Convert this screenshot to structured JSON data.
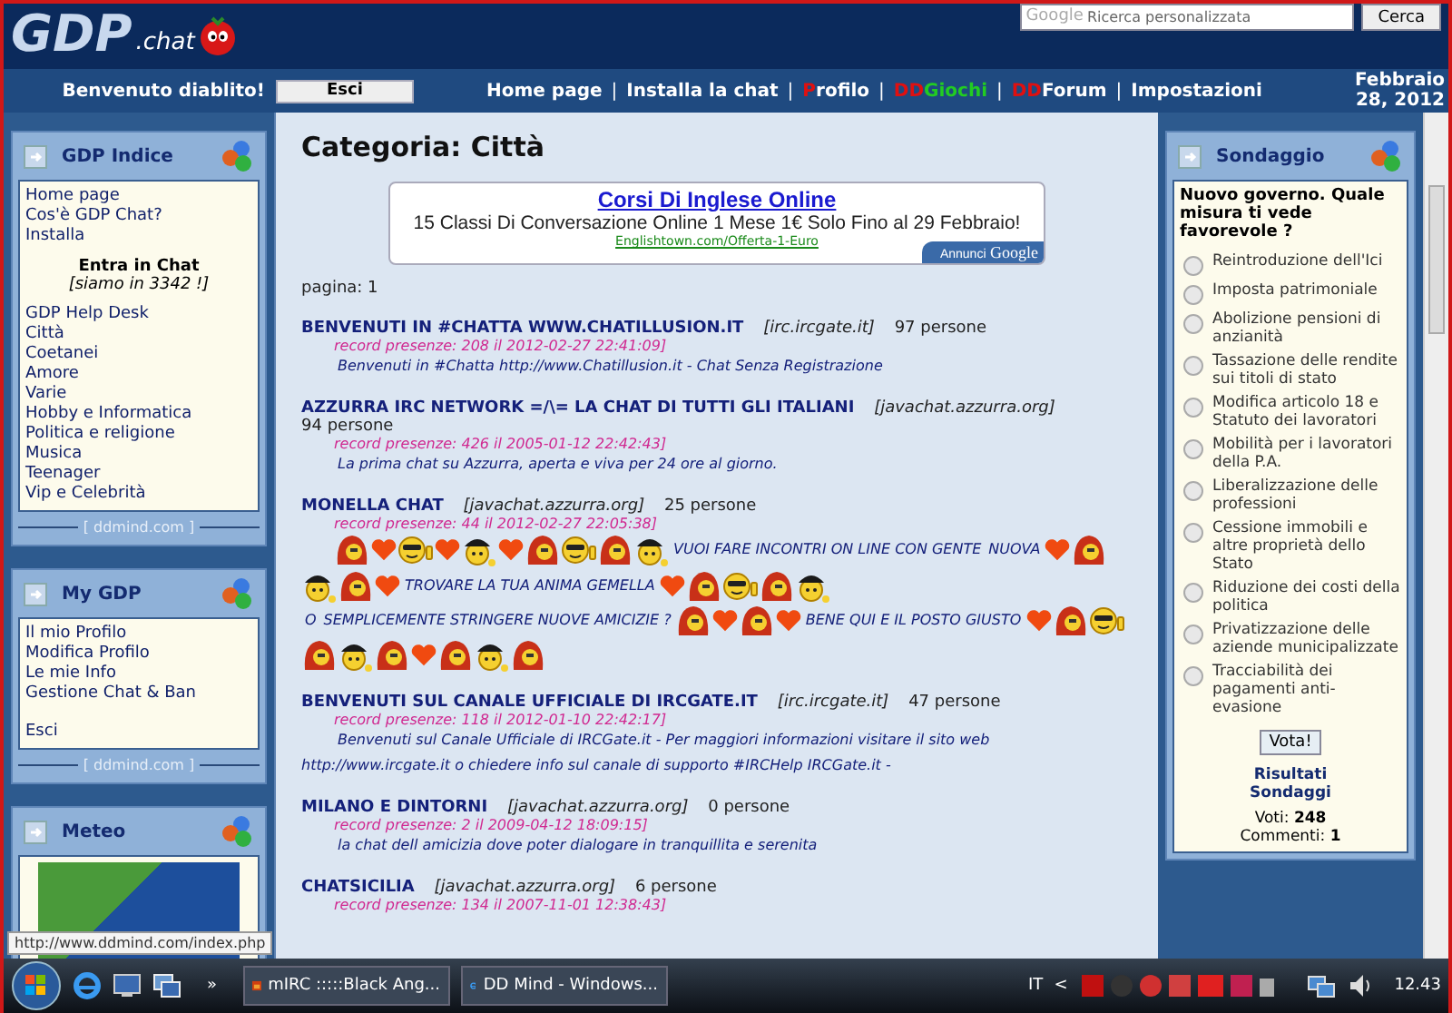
{
  "header": {
    "logo": "GDP",
    "logo_suffix": ".chat",
    "search": {
      "brand": "Google",
      "placeholder": "Ricerca personalizzata",
      "button": "Cerca"
    }
  },
  "navbar": {
    "welcome": "Benvenuto diablito!",
    "logout_button": "Esci",
    "links": [
      {
        "parts": [
          {
            "text": "Home page"
          }
        ]
      },
      {
        "parts": [
          {
            "text": "Installa la chat"
          }
        ]
      },
      {
        "parts": [
          {
            "text": "P",
            "color": "#e01010"
          },
          {
            "text": "rofilo"
          }
        ]
      },
      {
        "parts": [
          {
            "text": "DD",
            "color": "#e01010"
          },
          {
            "text": "Giochi",
            "color": "#22cc22"
          }
        ]
      },
      {
        "parts": [
          {
            "text": "DD",
            "color": "#e01010"
          },
          {
            "text": "Forum"
          }
        ]
      },
      {
        "parts": [
          {
            "text": "Impostazioni"
          }
        ]
      }
    ],
    "separator": "|",
    "date": "Febbraio 28, 2012"
  },
  "left_sidebar": [
    {
      "title": "GDP Indice",
      "kind": "index",
      "footer": "[ ddmind.com ]",
      "links_top": [
        "Home page",
        "Cos'è GDP Chat?",
        "Installa"
      ],
      "enter_title": "Entra in Chat",
      "enter_count": "[siamo in 3342 !]",
      "links": [
        "GDP Help Desk",
        "Città",
        "Coetanei",
        "Amore",
        "Varie",
        "Hobby e Informatica",
        "Politica e religione",
        "Musica",
        "Teenager",
        "Vip e Celebrità"
      ]
    },
    {
      "title": "My GDP",
      "kind": "links",
      "footer": "[ ddmind.com ]",
      "links_top": [
        "Il mio Profilo",
        "Modifica Profilo",
        "Le mie Info",
        "Gestione Chat & Ban"
      ],
      "links": [
        "Esci"
      ]
    },
    {
      "title": "Meteo",
      "kind": "image"
    }
  ],
  "main": {
    "heading": "Categoria: Città",
    "ad": {
      "title": "Corsi Di Inglese Online",
      "text": "15 Classi Di Conversazione Online 1 Mese 1€ Solo Fino al 29 Febbraio!",
      "url": "Englishtown.com/Offerta-1-Euro",
      "badge_prefix": "Annunci",
      "badge": "Google"
    },
    "page": "pagina: 1",
    "chats": [
      {
        "name": "BENVENUTI IN #CHATTA WWW.CHATILLUSION.IT",
        "server": "[irc.ircgate.it]",
        "count": "97 persone",
        "record": "record presenze: 208 il 2012-02-27 22:41:09]",
        "description": [
          {
            "kind": "text",
            "text": "Benvenuti in #Chatta http://www.Chatillusion.it - Chat Senza Registrazione"
          }
        ]
      },
      {
        "name": "AZZURRA IRC NETWORK =/\\= LA CHAT DI TUTTI GLI ITALIANI",
        "server": "[javachat.azzurra.org]",
        "count": "94 persone",
        "record": "record presenze: 426 il 2005-01-12 22:42:43]",
        "description": [
          {
            "kind": "text",
            "text": "La prima chat su Azzurra, aperta e viva per 24 ore al giorno."
          }
        ]
      },
      {
        "name": "MONELLA CHAT",
        "server": "[javachat.azzurra.org]",
        "count": "25 persone",
        "record": "record presenze: 44 il 2012-02-27 22:05:38]",
        "description": [
          {
            "kind": "redhead"
          },
          {
            "kind": "heart"
          },
          {
            "kind": "cool"
          },
          {
            "kind": "heart"
          },
          {
            "kind": "cop"
          },
          {
            "kind": "heart"
          },
          {
            "kind": "redhead"
          },
          {
            "kind": "cool"
          },
          {
            "kind": "redhead"
          },
          {
            "kind": "cop"
          },
          {
            "kind": "text",
            "text": "VUOI FARE INCONTRI ON LINE CON GENTE"
          },
          {
            "kind": "text",
            "text": "NUOVA"
          },
          {
            "kind": "heart"
          },
          {
            "kind": "redhead"
          },
          {
            "kind": "cop"
          },
          {
            "kind": "redhead"
          },
          {
            "kind": "heart"
          },
          {
            "kind": "text",
            "text": "TROVARE LA TUA ANIMA GEMELLA"
          },
          {
            "kind": "heart"
          },
          {
            "kind": "redhead"
          },
          {
            "kind": "cool"
          },
          {
            "kind": "redhead"
          },
          {
            "kind": "cop"
          },
          {
            "kind": "text",
            "text": "O"
          },
          {
            "kind": "text",
            "text": "SEMPLICEMENTE STRINGERE NUOVE AMICIZIE ?"
          },
          {
            "kind": "redhead"
          },
          {
            "kind": "heart"
          },
          {
            "kind": "redhead"
          },
          {
            "kind": "heart"
          },
          {
            "kind": "text",
            "text": "BENE QUI E IL POSTO GIUSTO"
          },
          {
            "kind": "heart"
          },
          {
            "kind": "redhead"
          },
          {
            "kind": "cool"
          },
          {
            "kind": "redhead"
          },
          {
            "kind": "cop"
          },
          {
            "kind": "redhead"
          },
          {
            "kind": "heart"
          },
          {
            "kind": "redhead"
          },
          {
            "kind": "cop"
          },
          {
            "kind": "redhead"
          }
        ]
      },
      {
        "name": "BENVENUTI SUL CANALE UFFICIALE DI IRCGATE.IT",
        "server": "[irc.ircgate.it]",
        "count": "47 persone",
        "record": "record presenze: 118 il 2012-01-10 22:42:17]",
        "description": [
          {
            "kind": "text",
            "text": "Benvenuti sul Canale Ufficiale di IRCGate.it - Per maggiori informazioni visitare il sito web http://www.ircgate.it o chiedere info sul canale di supporto #IRCHelp IRCGate.it -"
          }
        ]
      },
      {
        "name": "MILANO E DINTORNI",
        "server": "[javachat.azzurra.org]",
        "count": "0 persone",
        "record": "record presenze: 2 il 2009-04-12 18:09:15]",
        "description": [
          {
            "kind": "text",
            "text": "la chat dell amicizia dove poter dialogare in tranquillita e serenita"
          }
        ]
      },
      {
        "name": "CHATSICILIA",
        "server": "[javachat.azzurra.org]",
        "count": "6 persone",
        "record": "record presenze: 134 il 2007-11-01 12:38:43]"
      }
    ]
  },
  "poll": {
    "title": "Sondaggio",
    "question": "Nuovo governo. Quale misura ti vede favorevole ?",
    "options": [
      {
        "label": "Reintroduzione dell'Ici",
        "selected": false
      },
      {
        "label": "Imposta patrimoniale",
        "selected": false
      },
      {
        "label": "Abolizione pensioni di anzianità",
        "selected": false
      },
      {
        "label": "Tassazione delle rendite sui titoli di stato",
        "selected": false
      },
      {
        "label": "Modifica articolo 18 e Statuto dei lavoratori",
        "selected": false
      },
      {
        "label": "Mobilità per i lavoratori della P.A.",
        "selected": false
      },
      {
        "label": "Liberalizzazione delle professioni",
        "selected": false
      },
      {
        "label": "Cessione immobili e altre proprietà dello Stato",
        "selected": false
      },
      {
        "label": "Riduzione dei costi della politica",
        "selected": false
      },
      {
        "label": "Privatizzazione delle aziende municipalizzate",
        "selected": false
      },
      {
        "label": "Tracciabilità dei pagamenti anti-evasione",
        "selected": false
      }
    ],
    "vote_button": "Vota!",
    "results_link": "Risultati Sondaggi",
    "votes": "Voti: **248**",
    "comments": "Commenti: **1**"
  },
  "status_bar": {
    "url": "http://www.ddmind.com/index.php"
  },
  "taskbar": {
    "overflow": "»",
    "tasks": [
      {
        "label": "mIRC :::::Black Ang...",
        "kind": "irc"
      },
      {
        "label": "DD Mind - Windows...",
        "kind": "browser"
      }
    ],
    "language": "IT",
    "tray_toggle": "<",
    "clock": "12.43"
  }
}
